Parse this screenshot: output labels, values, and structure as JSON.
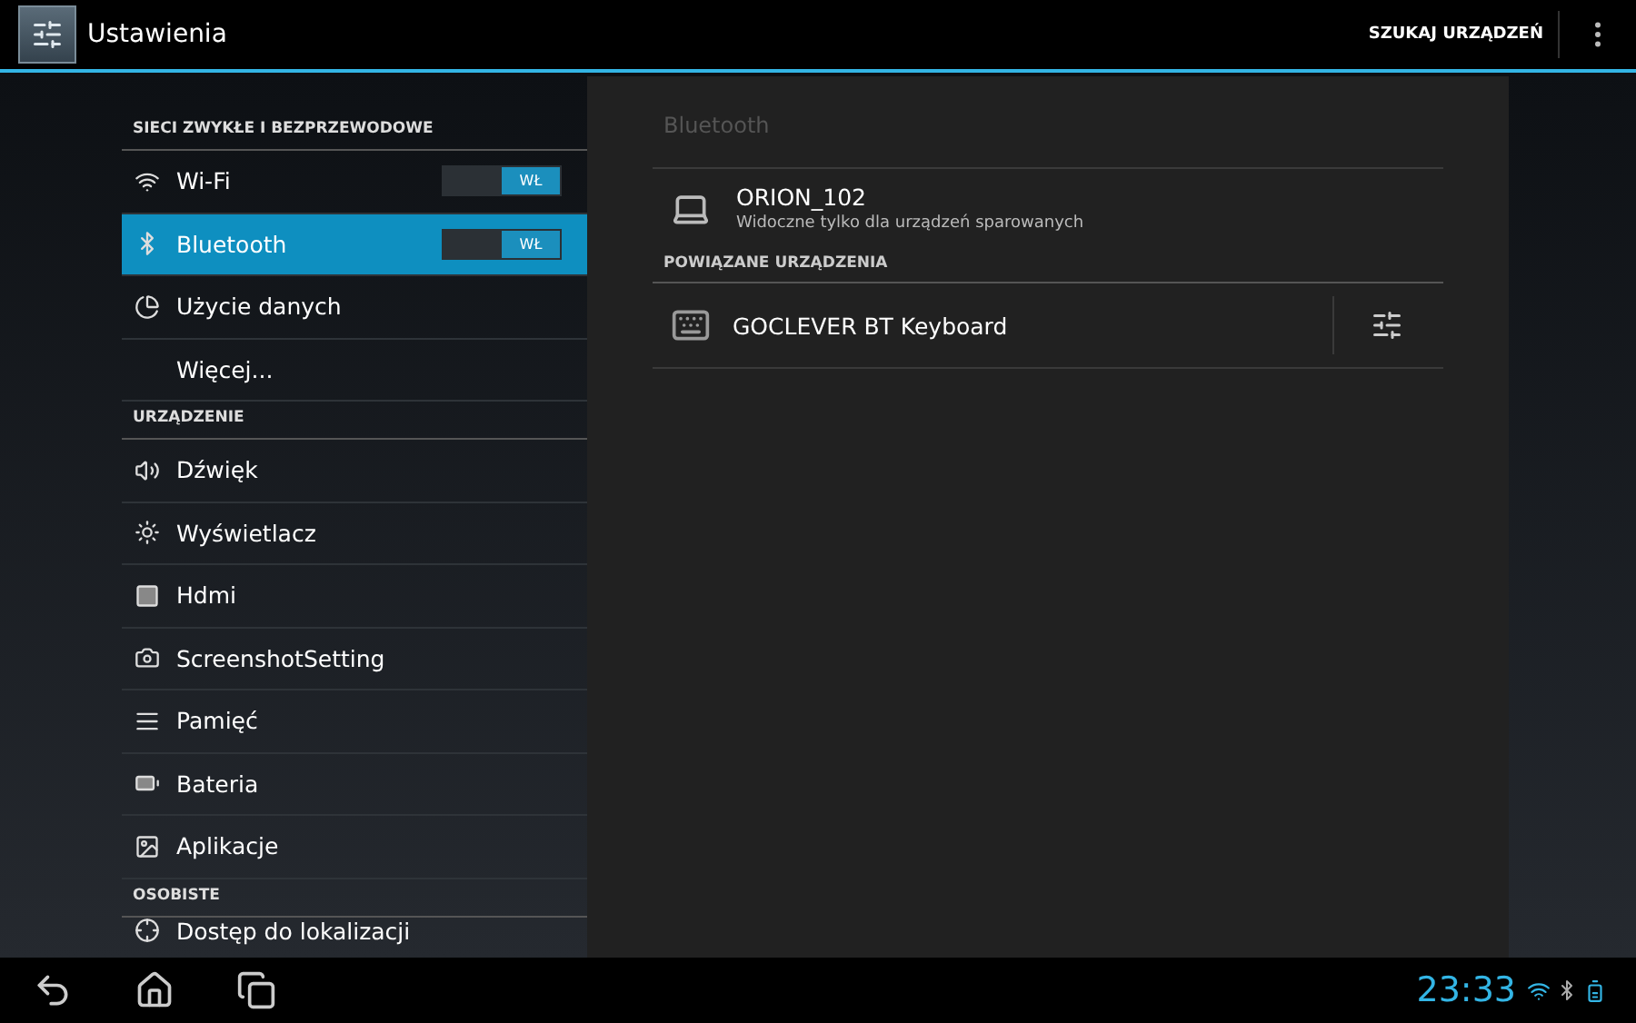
{
  "action_bar": {
    "title": "Ustawienia",
    "action": "SZUKAJ URZĄDZEŃ"
  },
  "sidebar": {
    "sections": [
      {
        "header": "SIECI ZWYKŁE I BEZPRZEWODOWE",
        "items": [
          {
            "label": "Wi-Fi",
            "selected": false,
            "kind": "toggle",
            "toggle": {
              "label": "WŁ",
              "on": true
            }
          },
          {
            "label": "Bluetooth",
            "selected": true,
            "kind": "toggle",
            "toggle": {
              "label": "WŁ",
              "on": true
            }
          },
          {
            "label": "Użycie danych",
            "selected": false,
            "kind": "plain"
          },
          {
            "label": "Więcej...",
            "selected": false,
            "kind": "plain"
          }
        ]
      },
      {
        "header": "URZĄDZENIE",
        "items": [
          {
            "label": "Dźwięk",
            "selected": false,
            "kind": "plain"
          },
          {
            "label": "Wyświetlacz",
            "selected": false,
            "kind": "plain"
          },
          {
            "label": "Hdmi",
            "selected": false,
            "kind": "plain"
          },
          {
            "label": "ScreenshotSetting",
            "selected": false,
            "kind": "plain"
          },
          {
            "label": "Pamięć",
            "selected": false,
            "kind": "plain"
          },
          {
            "label": "Bateria",
            "selected": false,
            "kind": "plain"
          },
          {
            "label": "Aplikacje",
            "selected": false,
            "kind": "plain"
          }
        ]
      },
      {
        "header": "OSOBISTE",
        "items": [
          {
            "label": "Dostęp do lokalizacji",
            "selected": false,
            "kind": "plain"
          }
        ]
      }
    ]
  },
  "detail": {
    "title": "Bluetooth",
    "device": {
      "name": "ORION_102",
      "subtitle": "Widoczne tylko dla urządzeń sparowanych"
    },
    "paired_header": "POWIĄZANE URZĄDZENIA",
    "paired": [
      {
        "name": "GOCLEVER BT Keyboard"
      }
    ]
  },
  "status_bar": {
    "time": "23:33"
  }
}
